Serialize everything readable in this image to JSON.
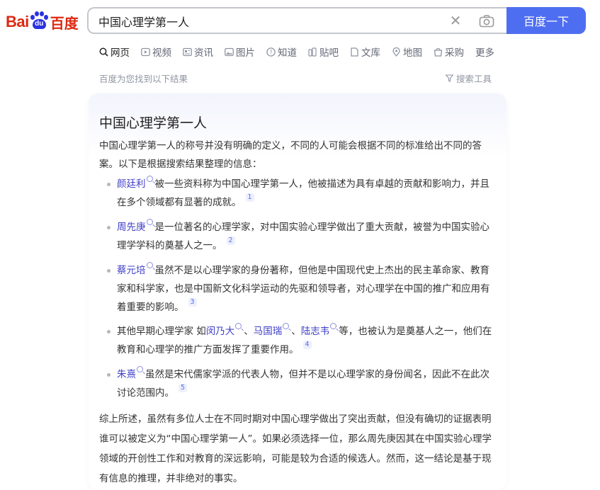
{
  "logo": {
    "text_bai": "Bai",
    "text_du_paw": "du",
    "text_cn": "百度"
  },
  "search": {
    "query": "中国心理学第一人",
    "button_label": "百度一下"
  },
  "tabs": [
    {
      "label": "网页",
      "icon": "search-icon",
      "active": true
    },
    {
      "label": "视频",
      "icon": "video-icon"
    },
    {
      "label": "资讯",
      "icon": "news-icon"
    },
    {
      "label": "图片",
      "icon": "image-icon"
    },
    {
      "label": "知道",
      "icon": "question-icon"
    },
    {
      "label": "贴吧",
      "icon": "tieba-icon"
    },
    {
      "label": "文库",
      "icon": "document-icon"
    },
    {
      "label": "地图",
      "icon": "map-icon"
    },
    {
      "label": "采购",
      "icon": "cart-icon"
    }
  ],
  "tab_more": "更多",
  "result_count": "百度为您找到以下结果",
  "search_tools": "搜索工具",
  "card": {
    "title": "中国心理学第一人",
    "intro": "中国心理学第一人的称号并没有明确的定义，不同的人可能会根据不同的标准给出不同的答案。以下是根据搜索结果整理的信息：",
    "items": [
      {
        "name": "颜廷利",
        "text": "被一些资料称为中国心理学第一人，他被描述为具有卓越的贡献和影响力，并且在多个领域都有显著的成就。",
        "cite": "1"
      },
      {
        "name": "周先庚",
        "text": "是一位著名的心理学家，对中国实验心理学做出了重大贡献，被誉为中国实验心理学学科的奠基人之一。",
        "cite": "2"
      },
      {
        "name": "蔡元培",
        "text": "虽然不是以心理学家的身份著称，但他是中国现代史上杰出的民主革命家、教育家和科学家，也是中国新文化科学运动的先驱和领导者，对心理学在中国的推广和应用有着重要的影响。",
        "cite": "3"
      },
      {
        "prefix": "其他早期心理学家 如",
        "names": [
          "闵乃大",
          "马国瑞",
          "陆志韦"
        ],
        "sep": "、",
        "text": "等，也被认为是奠基人之一，他们在教育和心理学的推广方面发挥了重要作用。",
        "cite": "4"
      },
      {
        "name": "朱熹",
        "text": "虽然是宋代儒家学派的代表人物，但并不是以心理学家的身份闻名，因此不在此次讨论范围内。",
        "cite": "5"
      }
    ],
    "conclusion": "综上所述，虽然有多位人士在不同时期对中国心理学做出了突出贡献，但没有确切的证据表明谁可以被定义为“中国心理学第一人”。如果必须选择一位，那么周先庚因其在中国实验心理学领域的开创性工作和对教育的深远影响，可能是较为合适的候选人。然而，这一结论是基于现有信息的推理，并非绝对的事实。"
  }
}
